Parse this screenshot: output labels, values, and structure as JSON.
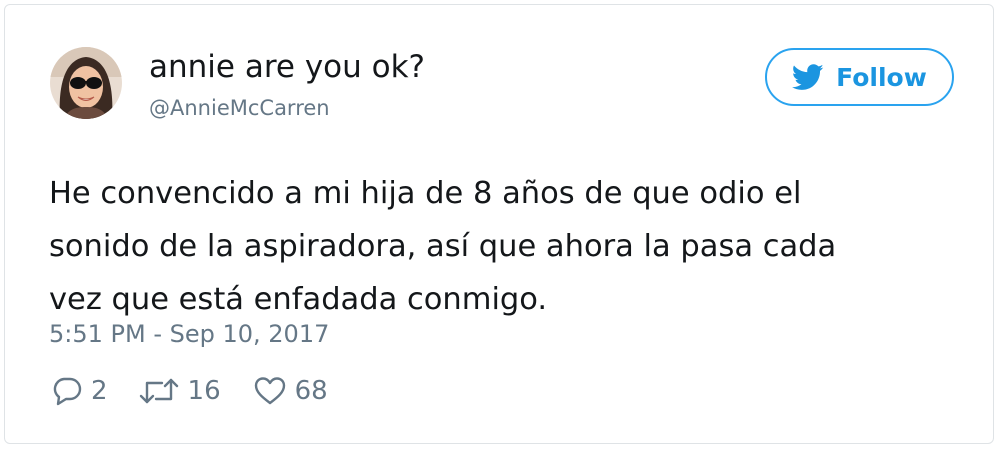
{
  "tweet": {
    "author": {
      "display_name": "annie are you ok?",
      "handle": "@AnnieMcCarren",
      "avatar_icon": "user-avatar"
    },
    "follow_button": {
      "label": "Follow",
      "icon": "twitter-bird-icon",
      "color": "#1b95e0"
    },
    "text_lines": [
      "He convencido a mi hija de 8 años de que odio el",
      "sonido de la aspiradora, así que ahora la pasa cada",
      "vez que está enfadada conmigo."
    ],
    "timestamp": "5:51 PM - Sep 10, 2017",
    "actions": {
      "reply": {
        "icon": "reply-icon",
        "count": "2"
      },
      "retweet": {
        "icon": "retweet-icon",
        "count": "16"
      },
      "like": {
        "icon": "heart-icon",
        "count": "68"
      }
    }
  }
}
